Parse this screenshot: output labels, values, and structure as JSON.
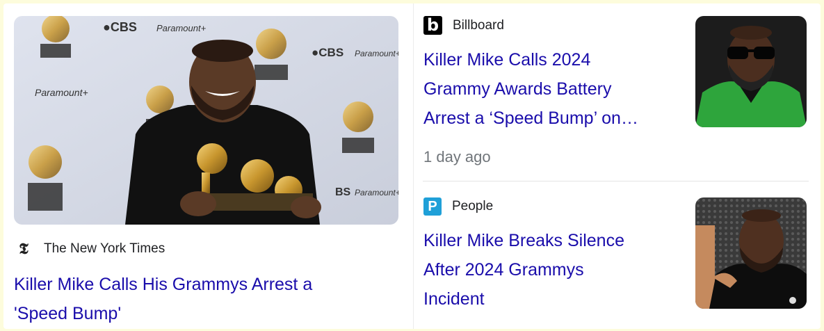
{
  "left_card": {
    "source": "The New York Times",
    "headline_line1": "Killer Mike Calls His Grammys Arrest a",
    "headline_line2": "'Speed Bump'",
    "image_text_brand1": "CBS",
    "image_text_brand2": "Paramount+"
  },
  "right_cards": [
    {
      "source": "Billboard",
      "logo_letter": "b",
      "headline_lines": [
        "Killer Mike Calls 2024",
        "Grammy Awards Battery",
        "Arrest a ‘Speed Bump’ on…"
      ],
      "time": "1 day ago"
    },
    {
      "source": "People",
      "logo_letter": "P",
      "headline_lines": [
        "Killer Mike Breaks Silence",
        "After 2024 Grammys",
        "Incident"
      ]
    }
  ],
  "colors": {
    "headline": "#1a0dab",
    "source": "#202124",
    "time": "#70757a",
    "page_bg": "#fdfcdc"
  }
}
